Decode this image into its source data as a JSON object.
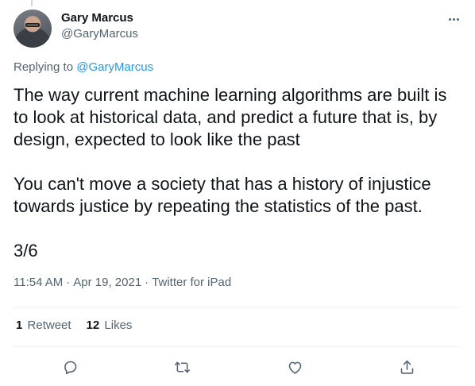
{
  "author": {
    "name": "Gary Marcus",
    "handle": "@GaryMarcus"
  },
  "reply": {
    "prefix": "Replying to",
    "handle": "@GaryMarcus"
  },
  "tweet": {
    "text": "The way current machine learning algorithms are built is to look at historical data, and predict a future that is, by design, expected to look like the past\n\nYou can't move a society that has a history of injustice towards justice by repeating the statistics of the past.\n\n3/6",
    "time": "11:54 AM",
    "date": "Apr 19, 2021",
    "source": "Twitter for iPad",
    "separator": "·"
  },
  "stats": {
    "retweets_count": "1",
    "retweets_label": "Retweet",
    "likes_count": "12",
    "likes_label": "Likes"
  },
  "icons": {
    "more": "more-icon",
    "reply": "reply-icon",
    "retweet": "retweet-icon",
    "like": "heart-icon",
    "share": "share-icon"
  },
  "colors": {
    "link": "#1d9bf0",
    "secondary_text": "#536471",
    "primary_text": "#0f1419"
  }
}
